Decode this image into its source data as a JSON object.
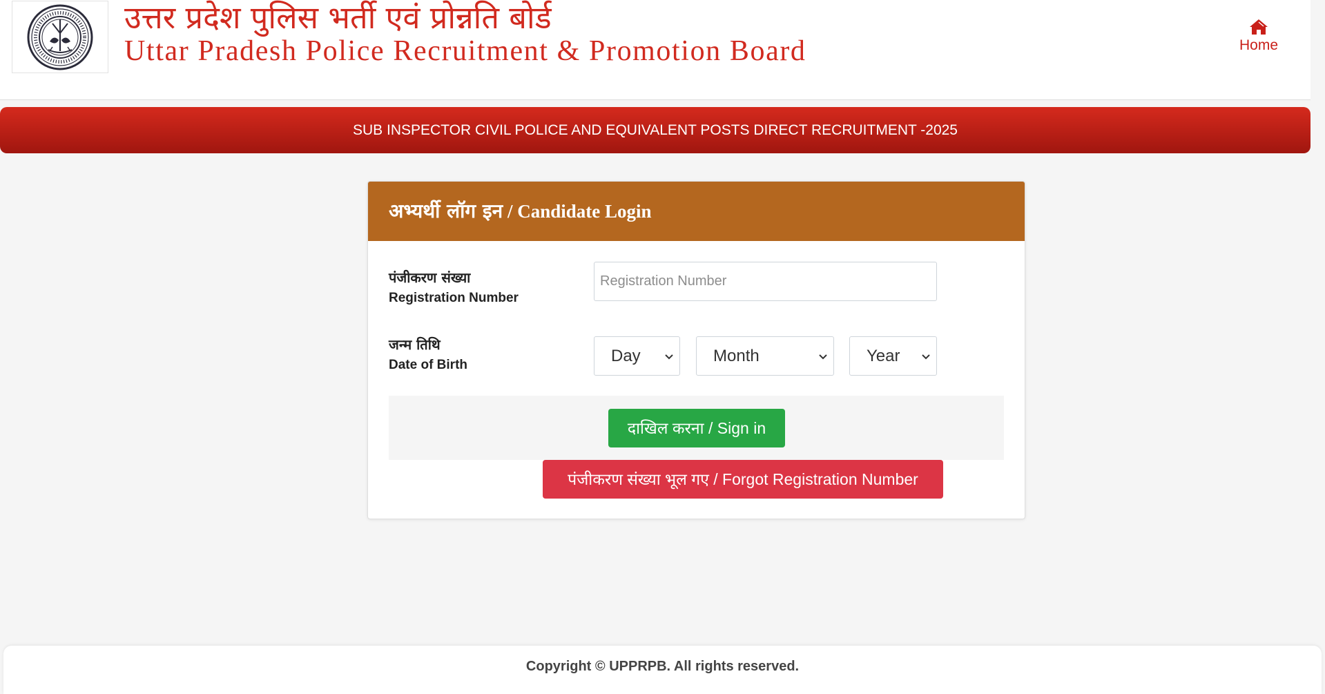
{
  "header": {
    "title_hindi": "उत्तर प्रदेश पुलिस भर्ती एवं प्रोन्नति बोर्ड",
    "title_english": "Uttar Pradesh Police Recruitment & Promotion Board",
    "home_label": "Home"
  },
  "banner": {
    "text": "SUB INSPECTOR CIVIL POLICE AND EQUIVALENT POSTS DIRECT RECRUITMENT -2025"
  },
  "login_card": {
    "title_hindi": "अभ्यर्थी लॉग इन",
    "title_english": "/ Candidate Login",
    "registration": {
      "label_hindi": "पंजीकरण संख्या",
      "label_english": "Registration Number",
      "value": "",
      "placeholder": "Registration Number"
    },
    "dob": {
      "label_hindi": "जन्म तिथि",
      "label_english": "Date of Birth",
      "day": "Day",
      "month": "Month",
      "year": "Year"
    },
    "signin_label": "दाखिल करना / Sign in",
    "forgot_label": "पंजीकरण संख्या भूल गए / Forgot Registration Number"
  },
  "footer": {
    "copyright": "Copyright © UPPRPB. All rights reserved."
  },
  "colors": {
    "brand_red": "#d12a1f",
    "card_header": "#b4671f",
    "signin_green": "#28a745",
    "forgot_red": "#dc3545"
  },
  "icons": {
    "logo": "police-emblem-seal",
    "home": "home-icon",
    "select": "chevron-down-icon"
  }
}
